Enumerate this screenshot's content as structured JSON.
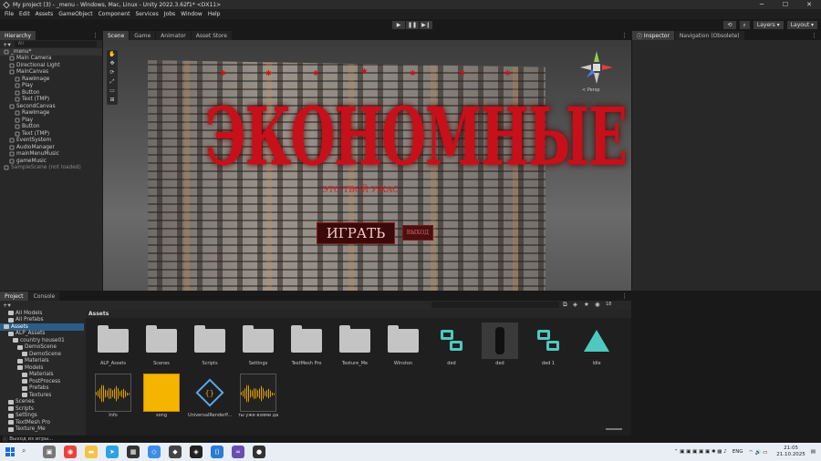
{
  "window": {
    "title": "My project (3) - _menu - Windows, Mac, Linux - Unity 2022.3.62f1* <DX11>"
  },
  "menu": [
    "File",
    "Edit",
    "Assets",
    "GameObject",
    "Component",
    "Services",
    "Jobs",
    "Window",
    "Help"
  ],
  "toolbar": {
    "layers": "Layers",
    "layout": "Layout"
  },
  "hierarchy": {
    "tab": "Hierarchy",
    "search_placeholder": "All",
    "items": [
      {
        "label": "_menu*",
        "depth": 0,
        "type": "scene"
      },
      {
        "label": "Main Camera",
        "depth": 1
      },
      {
        "label": "Directional Light",
        "depth": 1
      },
      {
        "label": "MainCanvas",
        "depth": 1
      },
      {
        "label": "RawImage",
        "depth": 2
      },
      {
        "label": "Play",
        "depth": 2
      },
      {
        "label": "Button",
        "depth": 2
      },
      {
        "label": "Text (TMP)",
        "depth": 2
      },
      {
        "label": "SecondCanvas",
        "depth": 1
      },
      {
        "label": "RawImage",
        "depth": 2
      },
      {
        "label": "Play",
        "depth": 2
      },
      {
        "label": "Button",
        "depth": 2
      },
      {
        "label": "Text (TMP)",
        "depth": 2
      },
      {
        "label": "EventSystem",
        "depth": 1
      },
      {
        "label": "AudioManager",
        "depth": 1
      },
      {
        "label": "mainMenuMusic",
        "depth": 1
      },
      {
        "label": "gameMusic",
        "depth": 1
      },
      {
        "label": "SampleScene (not loaded)",
        "depth": 0,
        "type": "grey"
      }
    ]
  },
  "scene_tabs": [
    "Scene",
    "Game",
    "Animator",
    "Asset Store"
  ],
  "scene": {
    "title": "ЭКОНОМНЫЕ",
    "subtitle": "ЭТО ТВОЙ УЖАС",
    "play_label": "ИГРАТЬ",
    "exit_label": "ВЫХОД",
    "persp": "< Persp"
  },
  "inspector_tabs": [
    "Inspector",
    "Navigation (Obsolete)"
  ],
  "project_tabs": [
    "Project",
    "Console"
  ],
  "project": {
    "count": "18",
    "tree": [
      {
        "label": "All Models",
        "depth": 1
      },
      {
        "label": "All Prefabs",
        "depth": 1
      },
      {
        "label": "Assets",
        "depth": 0,
        "sel": true
      },
      {
        "label": "ALP_Assets",
        "depth": 1
      },
      {
        "label": "country house01",
        "depth": 2
      },
      {
        "label": "DemoScene",
        "depth": 3
      },
      {
        "label": "DemoScene",
        "depth": 4
      },
      {
        "label": "Materials",
        "depth": 3
      },
      {
        "label": "Models",
        "depth": 3
      },
      {
        "label": "Materials",
        "depth": 4
      },
      {
        "label": "PostProcess",
        "depth": 4
      },
      {
        "label": "Prefabs",
        "depth": 4
      },
      {
        "label": "Textures",
        "depth": 4
      },
      {
        "label": "Scenes",
        "depth": 1
      },
      {
        "label": "Scripts",
        "depth": 1
      },
      {
        "label": "Settings",
        "depth": 1
      },
      {
        "label": "TextMesh Pro",
        "depth": 1
      },
      {
        "label": "Texture_Me",
        "depth": 1
      }
    ],
    "breadcrumb": "Assets",
    "assets": [
      {
        "label": "ALP_Assets",
        "kind": "folder"
      },
      {
        "label": "Scenes",
        "kind": "folder"
      },
      {
        "label": "Scripts",
        "kind": "folder"
      },
      {
        "label": "Settings",
        "kind": "folder"
      },
      {
        "label": "TextMesh Pro",
        "kind": "folder"
      },
      {
        "label": "Texture_Me",
        "kind": "folder"
      },
      {
        "label": "Winston",
        "kind": "folder"
      },
      {
        "label": "ded",
        "kind": "prefab"
      },
      {
        "label": "ded",
        "kind": "model"
      },
      {
        "label": "ded 1",
        "kind": "prefab"
      },
      {
        "label": "Idle",
        "kind": "anim"
      },
      {
        "label": "Info",
        "kind": "audio"
      },
      {
        "label": "song",
        "kind": "audio-full"
      },
      {
        "label": "UniversalRenderP...",
        "kind": "pipeline"
      },
      {
        "label": "ты уже взями да",
        "kind": "audio"
      }
    ]
  },
  "status": "Выход из игры...",
  "tray": {
    "lang": "ENG",
    "time": "21:05",
    "date": "21.10.2025"
  }
}
